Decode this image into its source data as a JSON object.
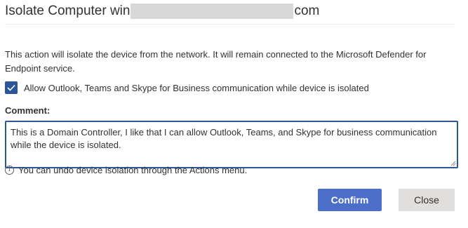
{
  "dialog": {
    "title_prefix": "Isolate Computer win",
    "title_suffix": "com",
    "description": "This action will isolate the device from the network. It will remain connected to the Microsoft Defender for Endpoint service.",
    "checkbox": {
      "label": "Allow Outlook, Teams and Skype for Business communication while device is isolated",
      "checked": true
    },
    "comment_label": "Comment:",
    "comment_value": "This is a Domain Controller, I like that I can allow Outlook, Teams, and Skype for business communication while the device is isolated.",
    "info_text": "You can undo device isolation through the Actions menu.",
    "confirm_label": "Confirm",
    "close_label": "Close"
  },
  "colors": {
    "accent": "#2b579a",
    "primary_button": "#4b6fc9",
    "secondary_button": "#e1dfdd",
    "redaction": "#d8d8d8"
  },
  "icons": {
    "checkbox": "checkmark-icon",
    "info": "info-icon"
  }
}
